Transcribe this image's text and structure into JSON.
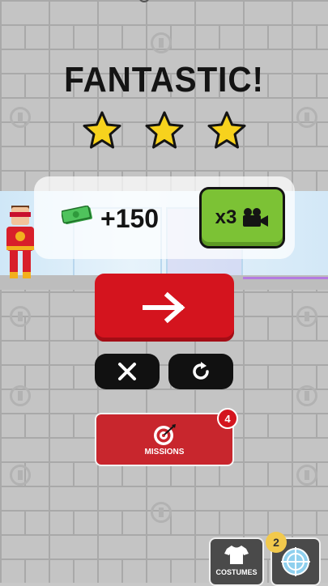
{
  "header": {
    "title": "FANTASTIC!",
    "stars_earned": 3,
    "stars_total": 3
  },
  "reward": {
    "amount": "+150",
    "multiplier_label": "x3"
  },
  "actions": {
    "next_icon": "arrow-right-icon",
    "close_icon": "close-icon",
    "restart_icon": "restart-icon"
  },
  "missions": {
    "label": "MISSIONS",
    "badge_count": "4"
  },
  "bottom": {
    "costumes_label": "COSTUMES",
    "aim_badge_count": "2"
  },
  "colors": {
    "accent_red": "#d4141e",
    "video_green": "#7cc235",
    "star_yellow": "#f7d21d"
  }
}
